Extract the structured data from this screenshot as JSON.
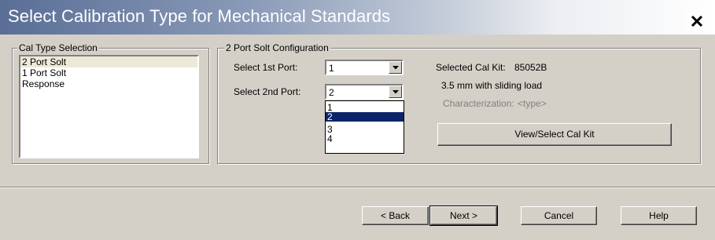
{
  "window": {
    "title": "Select Calibration Type for Mechanical Standards",
    "close_glyph": "✕"
  },
  "cal_type_group": {
    "legend": "Cal Type Selection",
    "items": [
      "2 Port Solt",
      "1 Port Solt",
      "Response"
    ],
    "selected": "2 Port Solt"
  },
  "config_group": {
    "legend": "2 Port Solt Configuration",
    "port1": {
      "label": "Select 1st Port:",
      "value": "1"
    },
    "port2": {
      "label": "Select 2nd Port:",
      "value": "2",
      "options": [
        "1",
        "2",
        "3",
        "4"
      ],
      "highlighted": "2"
    },
    "cal_kit": {
      "label": "Selected Cal Kit:",
      "value": "85052B",
      "description": "3.5 mm with sliding load",
      "characterization_label": "Characterization:",
      "characterization_value": "<type>"
    },
    "view_button": "View/Select Cal Kit"
  },
  "footer": {
    "back": "< Back",
    "next": "Next >",
    "cancel": "Cancel",
    "help": "Help"
  },
  "colors": {
    "selection": "#0a246a",
    "face": "#d4d0c8",
    "title_start": "#5a6e96"
  }
}
